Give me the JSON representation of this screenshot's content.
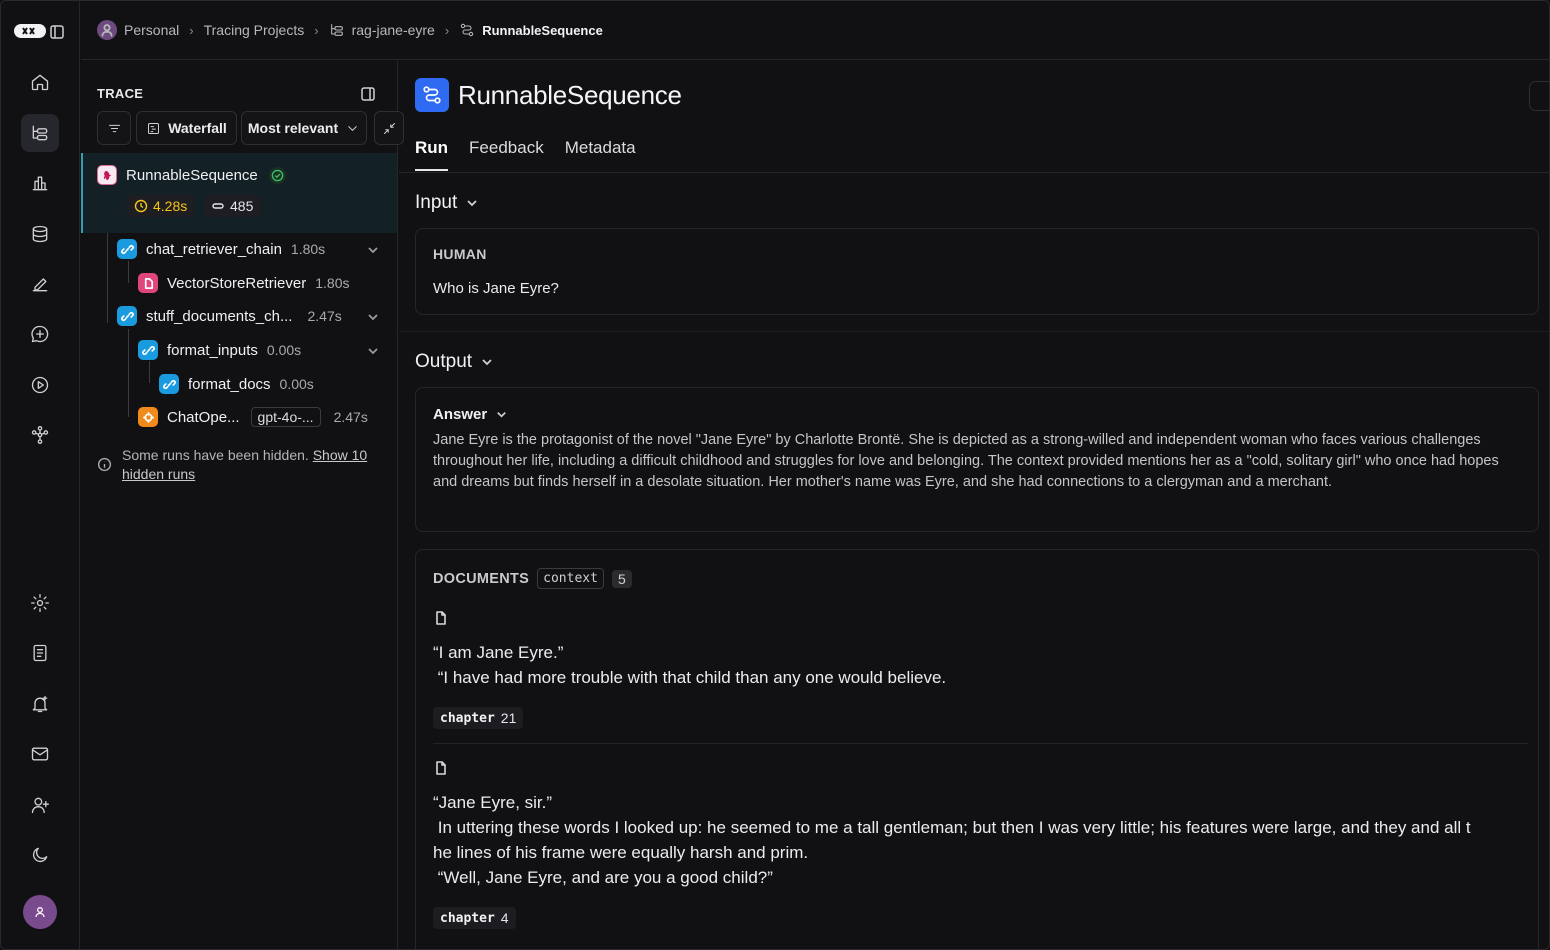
{
  "breadcrumbs": {
    "workspace": "Personal",
    "projects": "Tracing Projects",
    "project": "rag-jane-eyre",
    "current": "RunnableSequence"
  },
  "trace": {
    "title": "TRACE",
    "view_label": "Waterfall",
    "sort_label": "Most relevant",
    "root": {
      "name": "RunnableSequence",
      "latency": "4.28s",
      "tokens": "485"
    },
    "nodes": [
      {
        "name": "chat_retriever_chain",
        "time": "1.80s"
      },
      {
        "name": "VectorStoreRetriever",
        "time": "1.80s"
      },
      {
        "name": "stuff_documents_ch...",
        "time": "2.47s"
      },
      {
        "name": "format_inputs",
        "time": "0.00s"
      },
      {
        "name": "format_docs",
        "time": "0.00s"
      },
      {
        "name": "ChatOpe...",
        "tag": "gpt-4o-...",
        "time": "2.47s"
      }
    ],
    "hidden_note": "Some runs have been hidden.",
    "hidden_link": "Show 10 hidden runs"
  },
  "run": {
    "title": "RunnableSequence",
    "tabs": [
      "Run",
      "Feedback",
      "Metadata"
    ],
    "input_title": "Input",
    "input_role": "HUMAN",
    "input_text": "Who is Jane Eyre?",
    "output_title": "Output",
    "answer_label": "Answer",
    "answer_text": "Jane Eyre is the protagonist of the novel \"Jane Eyre\" by Charlotte Brontë. She is depicted as a strong-willed and independent woman who faces various challenges throughout her life, including a difficult childhood and struggles for love and belonging. The context provided mentions her as a \"cold, solitary girl\" who once had hopes and dreams but finds herself in a desolate situation. Her mother's name was Eyre, and she had connections to a clergyman and a merchant.",
    "documents_label": "DOCUMENTS",
    "documents_key": "context",
    "documents_count": "5",
    "documents": [
      {
        "text": "“I am Jane Eyre.”\n “I have had more trouble with that child than any one would believe.",
        "meta_key": "chapter",
        "meta_value": "21"
      },
      {
        "text": "“Jane Eyre, sir.”\n In uttering these words I looked up: he seemed to me a tall gentleman; but then I was very little; his features were large, and they and all t\nhe lines of his frame were equally harsh and prim.\n “Well, Jane Eyre, and are you a good child?”",
        "meta_key": "chapter",
        "meta_value": "4"
      }
    ]
  },
  "colors": {
    "background": "#111113",
    "accent_blue": "#2f6bf2",
    "chain_icon": "#1a9be0",
    "retriever_icon": "#e0457b",
    "llm_icon": "#f08a1c",
    "latency_yellow": "#f5c518",
    "success_green": "#3fb96a"
  }
}
